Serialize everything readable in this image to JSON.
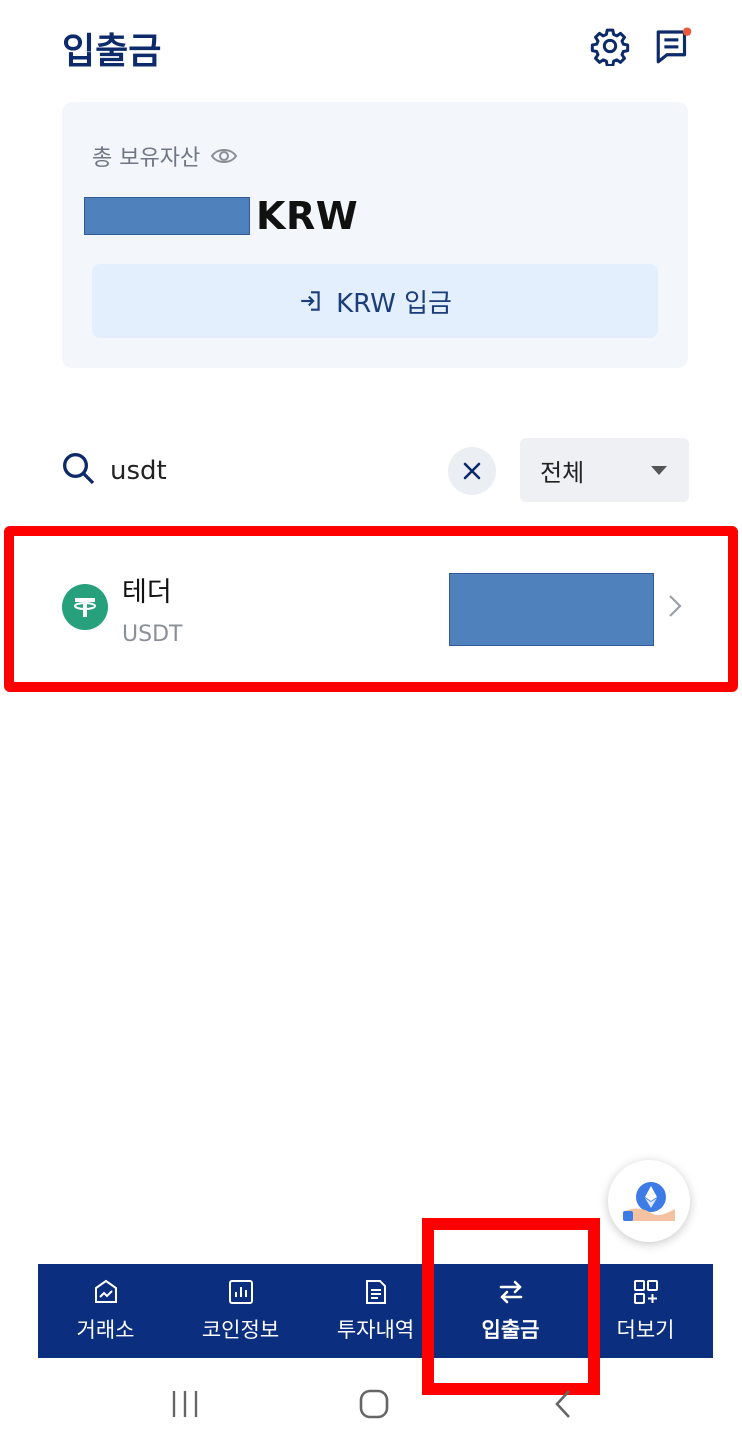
{
  "header": {
    "title": "입출금",
    "settings_icon": "gear-icon",
    "notice_icon": "message-icon",
    "notice_dot_color": "#e85a3c"
  },
  "asset_card": {
    "label": "총 보유자산",
    "visibility_icon": "eye-icon",
    "currency": "KRW",
    "deposit_button_label": "KRW 입금"
  },
  "search": {
    "value": "usdt",
    "filter_selected": "전체"
  },
  "coins": [
    {
      "name": "테더",
      "symbol": "USDT",
      "logo_letter": "T",
      "logo_color": "#26a17b"
    }
  ],
  "bottom_nav": {
    "items": [
      {
        "label": "거래소",
        "icon": "chart-up-icon",
        "active": false
      },
      {
        "label": "코인정보",
        "icon": "bar-chart-icon",
        "active": false
      },
      {
        "label": "투자내역",
        "icon": "document-icon",
        "active": false
      },
      {
        "label": "입출금",
        "icon": "transfer-arrows-icon",
        "active": true
      },
      {
        "label": "더보기",
        "icon": "grid-plus-icon",
        "active": false
      }
    ],
    "background": "#0b2f7e"
  },
  "colors": {
    "accent": "#0d2a6b",
    "redaction": "#4f81bd",
    "highlight": "#ff0000"
  }
}
